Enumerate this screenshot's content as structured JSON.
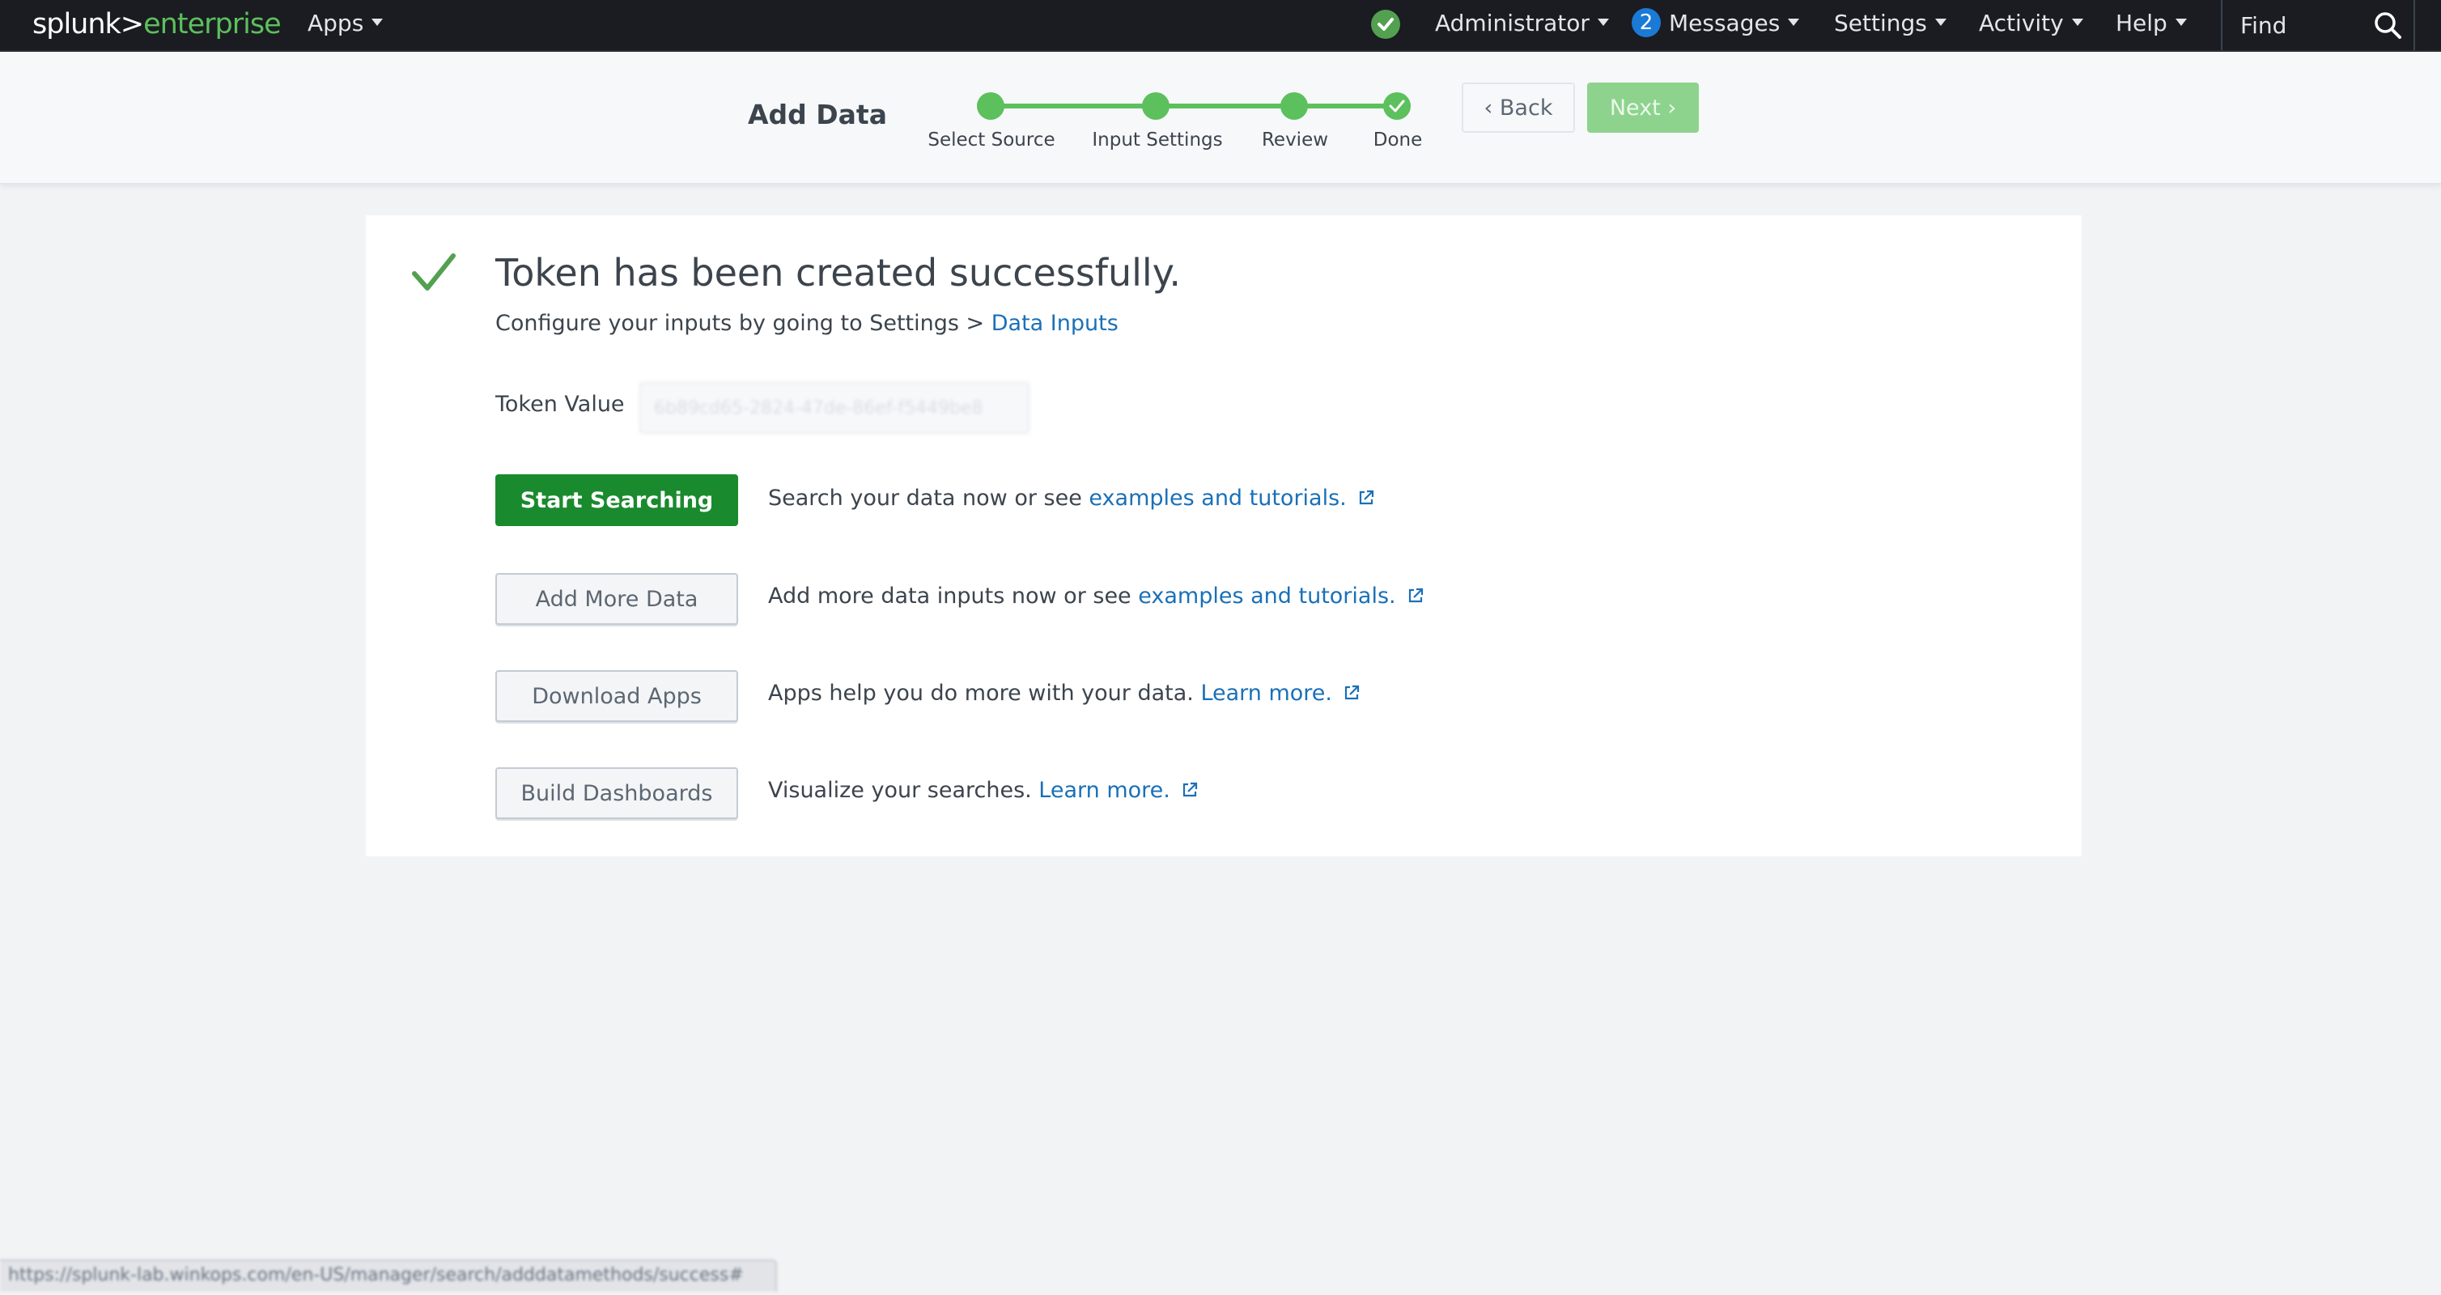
{
  "topbar": {
    "logo_left": "splunk>",
    "logo_right": "enterprise",
    "apps": "Apps",
    "user": "Administrator",
    "messages_count": "2",
    "messages": "Messages",
    "settings": "Settings",
    "activity": "Activity",
    "help": "Help",
    "find_placeholder": "Find"
  },
  "wizard": {
    "title": "Add Data",
    "steps": [
      {
        "label": "Select Source",
        "state": "complete"
      },
      {
        "label": "Input Settings",
        "state": "complete"
      },
      {
        "label": "Review",
        "state": "complete"
      },
      {
        "label": "Done",
        "state": "current-complete"
      }
    ],
    "back_label": "‹ Back",
    "next_label": "Next ›"
  },
  "main": {
    "title": "Token has been created successfully.",
    "subtitle_prefix": "Configure your inputs by going to Settings > ",
    "subtitle_link": "Data Inputs",
    "token_label": "Token Value",
    "token_value": "6b89cd65-2824-47de-86ef-f5449be8",
    "actions": [
      {
        "button": "Start Searching",
        "text": "Search your data now or see ",
        "link": "examples and tutorials."
      },
      {
        "button": "Add More Data",
        "text": "Add more data inputs now or see ",
        "link": "examples and tutorials."
      },
      {
        "button": "Download Apps",
        "text": "Apps help you do more with your data. ",
        "link": "Learn more."
      },
      {
        "button": "Build Dashboards",
        "text": "Visualize your searches. ",
        "link": "Learn more."
      }
    ]
  },
  "statusbar": {
    "url": "https://splunk-lab.winkops.com/en-US/manager/search/adddatamethods/success#"
  },
  "colors": {
    "topbar_bg": "#1a1c21",
    "brand_green": "#5cc05c",
    "primary_button": "#1a8a2e",
    "link": "#1a70b8",
    "message_badge": "#1a7ad6"
  }
}
